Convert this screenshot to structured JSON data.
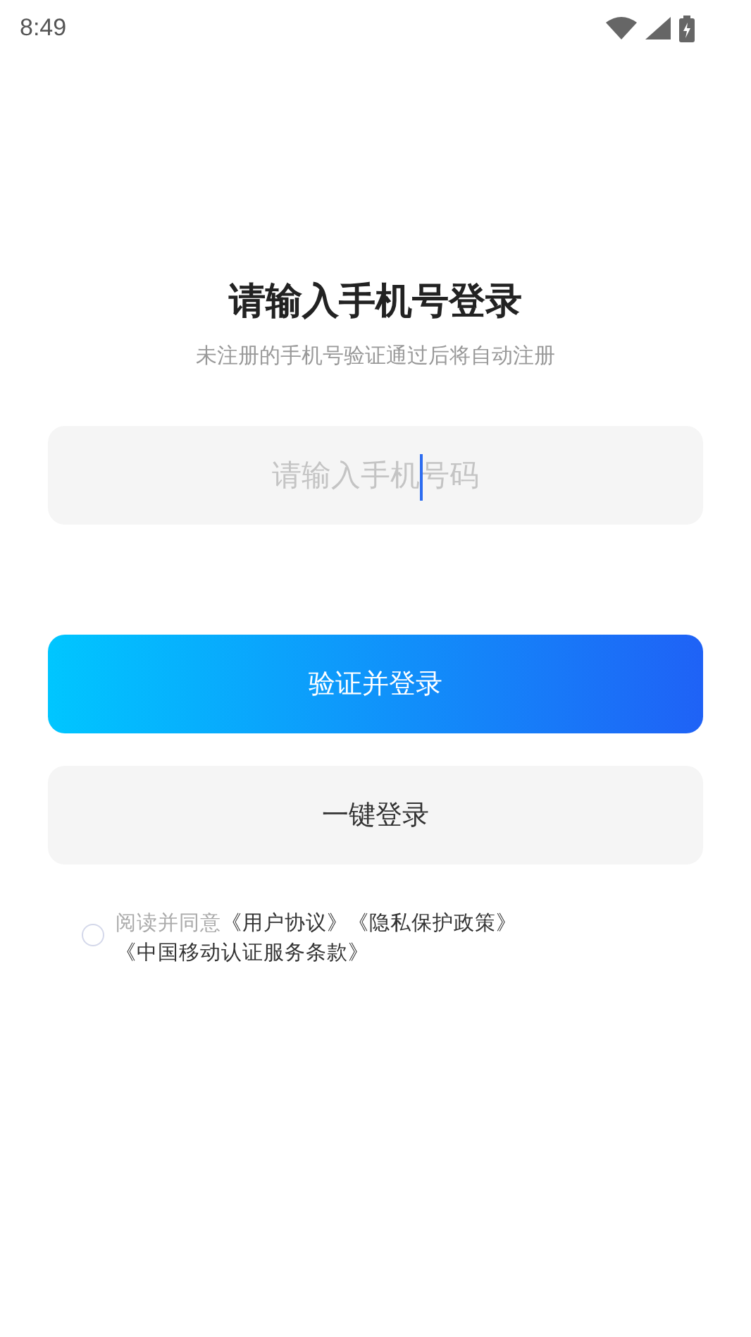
{
  "status_bar": {
    "time": "8:49"
  },
  "title": "请输入手机号登录",
  "subtitle": "未注册的手机号验证通过后将自动注册",
  "phone_field": {
    "placeholder": "请输入手机号码",
    "focused": true
  },
  "buttons": [
    {
      "label": "验证并登录",
      "kind": "primary"
    },
    {
      "label": "一键登录",
      "kind": "secondary"
    }
  ],
  "agreement": {
    "checked": false,
    "text": "阅读并同意",
    "links": [
      "《用户协议》",
      "《隐私保护政策》",
      "《中国移动认证服务条款》"
    ]
  }
}
